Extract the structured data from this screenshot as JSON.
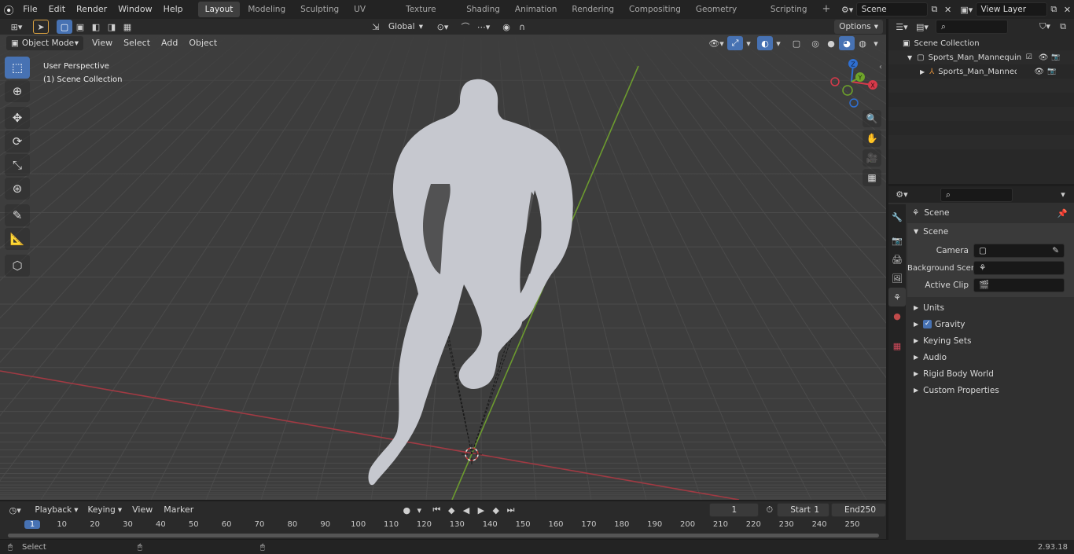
{
  "topbar": {
    "menus": [
      "File",
      "Edit",
      "Render",
      "Window",
      "Help"
    ],
    "workspaces": [
      "Layout",
      "Modeling",
      "Sculpting",
      "UV Editing",
      "Texture Paint",
      "Shading",
      "Animation",
      "Rendering",
      "Compositing",
      "Geometry Nodes",
      "Scripting"
    ],
    "active_workspace": "Layout",
    "scene_name": "Scene",
    "view_layer": "View Layer"
  },
  "viewport_header": {
    "mode": "Object Mode",
    "menus": [
      "View",
      "Select",
      "Add",
      "Object"
    ],
    "transform_orientation": "Global",
    "options_label": "Options"
  },
  "viewport": {
    "perspective_label": "User Perspective",
    "collection_label": "(1) Scene Collection",
    "gizmo_axes": [
      "X",
      "Y",
      "Z"
    ],
    "colors": {
      "bg": "#3d3d3d",
      "grid": "#4a4a4a",
      "x_axis": "#a13a43",
      "y_axis": "#6c9a2f",
      "mannequin": "#c6c8cf"
    }
  },
  "outliner": {
    "search_placeholder": "",
    "root": "Scene Collection",
    "items": [
      {
        "name": "Sports_Man_Mannequin_Sittir",
        "level": 1
      },
      {
        "name": "Sports_Man_Mannequin_:",
        "level": 2
      }
    ]
  },
  "properties": {
    "context_title": "Scene",
    "section": "Scene",
    "fields": [
      {
        "label": "Camera",
        "value": ""
      },
      {
        "label": "Background Scene",
        "value": ""
      },
      {
        "label": "Active Clip",
        "value": ""
      }
    ],
    "panels": [
      "Units",
      "Gravity",
      "Keying Sets",
      "Audio",
      "Rigid Body World",
      "Custom Properties"
    ],
    "gravity_checked": true
  },
  "timeline": {
    "menus": [
      "Playback",
      "Keying",
      "View",
      "Marker"
    ],
    "current_frame": "1",
    "start_label": "Start",
    "start_value": "1",
    "end_label": "End",
    "end_value": "250",
    "ruler": [
      "1",
      "10",
      "20",
      "30",
      "40",
      "50",
      "60",
      "70",
      "80",
      "90",
      "100",
      "110",
      "120",
      "130",
      "140",
      "150",
      "160",
      "170",
      "180",
      "190",
      "200",
      "210",
      "220",
      "230",
      "240",
      "250"
    ]
  },
  "statusbar": {
    "left": "Select",
    "version": "2.93.18"
  }
}
